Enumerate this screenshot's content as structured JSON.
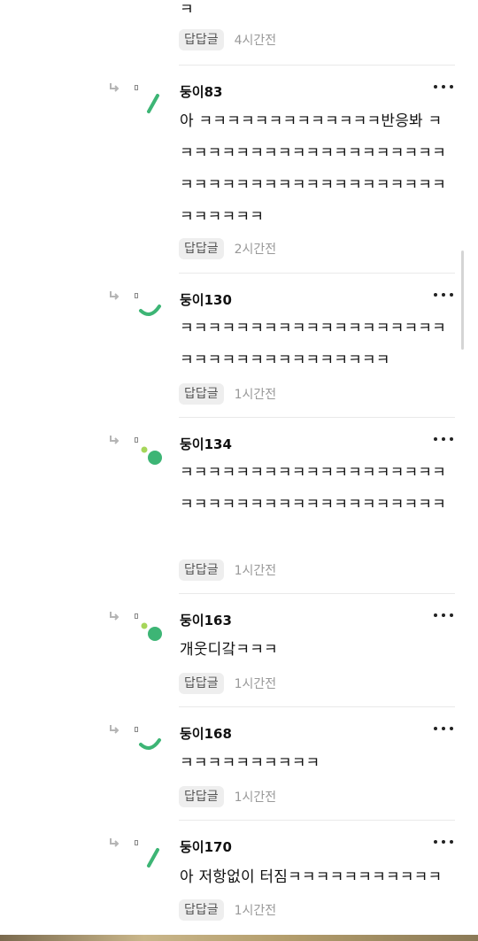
{
  "top": {
    "text": "ㅋ",
    "reply_label": "답답글",
    "time": "4시간전"
  },
  "comments": [
    {
      "author": "둥이83",
      "text": "아 ㅋㅋㅋㅋㅋㅋㅋㅋㅋㅋㅋㅋㅋ반응봐 ㅋㅋㅋㅋㅋㅋㅋㅋㅋㅋㅋㅋㅋㅋㅋㅋㅋㅋㅋㅋㅋㅋㅋㅋㅋㅋㅋㅋㅋㅋㅋㅋㅋㅋㅋㅋㅋㅋㅋㅋㅋㅋㅋㅋㅋ",
      "reply_label": "답답글",
      "time": "2시간전",
      "avatar": "green-slash"
    },
    {
      "author": "둥이130",
      "text": "ㅋㅋㅋㅋㅋㅋㅋㅋㅋㅋㅋㅋㅋㅋㅋㅋㅋㅋㅋㅋㅋㅋㅋㅋㅋㅋㅋㅋㅋㅋㅋㅋㅋㅋ",
      "reply_label": "답답글",
      "time": "1시간전",
      "avatar": "green-arc"
    },
    {
      "author": "둥이134",
      "text": "ㅋㅋㅋㅋㅋㅋㅋㅋㅋㅋㅋㅋㅋㅋㅋㅋㅋㅋㅋㅋㅋㅋㅋㅋㅋㅋㅋㅋㅋㅋㅋㅋㅋㅋㅋㅋㅋㅋ",
      "reply_label": "답답글",
      "time": "1시간전",
      "avatar": "green-dots"
    },
    {
      "author": "둥이163",
      "text": "개웃디갘ㅋㅋㅋ",
      "reply_label": "답답글",
      "time": "1시간전",
      "avatar": "green-dots"
    },
    {
      "author": "둥이168",
      "text": "ㅋㅋㅋㅋㅋㅋㅋㅋㅋㅋ",
      "reply_label": "답답글",
      "time": "1시간전",
      "avatar": "green-arc"
    },
    {
      "author": "둥이170",
      "text": "아 저항없이 터짐ㅋㅋㅋㅋㅋㅋㅋㅋㅋㅋㅋ",
      "reply_label": "답답글",
      "time": "1시간전",
      "avatar": "green-slash"
    }
  ],
  "colors": {
    "accent_green": "#3db575",
    "light_green": "#a6d65a",
    "divider": "#e9e9e9"
  }
}
